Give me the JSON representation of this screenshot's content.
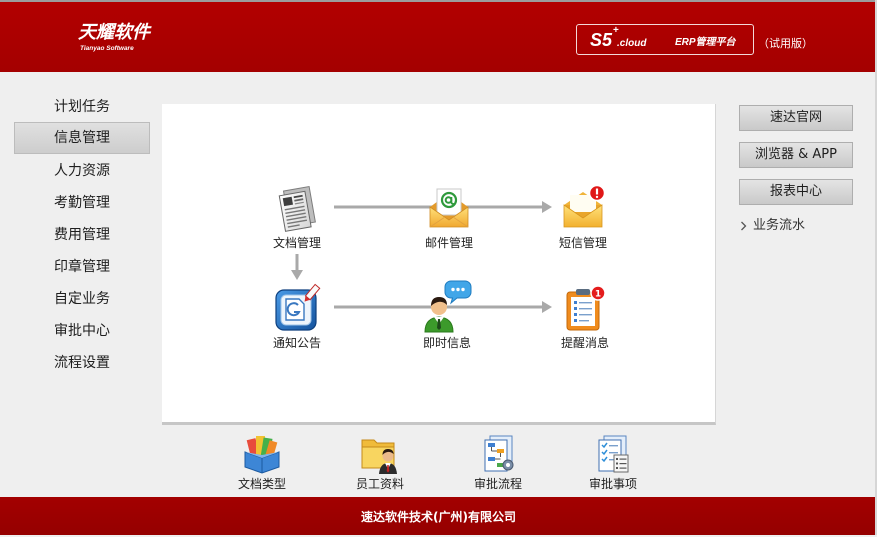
{
  "header": {
    "logo_cn": "天耀软件",
    "logo_en": "Tianyao Software",
    "product": {
      "name": "S5",
      "sup": "+",
      "suffix": ".cloud",
      "platform": "ERP管理平台"
    },
    "edition": "（试用版）"
  },
  "sidebar": {
    "items": [
      {
        "label": "计划任务",
        "selected": false
      },
      {
        "label": "信息管理",
        "selected": true
      },
      {
        "label": "人力资源",
        "selected": false
      },
      {
        "label": "考勤管理",
        "selected": false
      },
      {
        "label": "费用管理",
        "selected": false
      },
      {
        "label": "印章管理",
        "selected": false
      },
      {
        "label": "自定业务",
        "selected": false
      },
      {
        "label": "审批中心",
        "selected": false
      },
      {
        "label": "流程设置",
        "selected": false
      }
    ]
  },
  "flow": {
    "nodes": [
      {
        "label": "文档管理",
        "icon": "document-icon"
      },
      {
        "label": "邮件管理",
        "icon": "mail-icon"
      },
      {
        "label": "短信管理",
        "icon": "sms-icon"
      },
      {
        "label": "通知公告",
        "icon": "notice-icon"
      },
      {
        "label": "即时信息",
        "icon": "chat-icon"
      },
      {
        "label": "提醒消息",
        "icon": "reminder-icon",
        "badge": "1"
      }
    ]
  },
  "quick_links": [
    {
      "label": "文档类型",
      "icon": "document-types-icon"
    },
    {
      "label": "员工资料",
      "icon": "employee-folder-icon"
    },
    {
      "label": "审批流程",
      "icon": "approval-flow-icon"
    },
    {
      "label": "审批事项",
      "icon": "approval-items-icon"
    }
  ],
  "right_panel": {
    "buttons": [
      {
        "label": "速达官网"
      },
      {
        "label": "浏览器 & APP"
      },
      {
        "label": "报表中心"
      }
    ],
    "links": [
      {
        "label": "业务流水",
        "icon": "chevron-right-icon"
      }
    ]
  },
  "footer": {
    "company": "速达软件技术(广州)有限公司"
  },
  "colors": {
    "header_bg": "#b20000",
    "footer_bg": "#a30000",
    "page_bg": "#efefef",
    "arrow": "#a9a9a9"
  }
}
